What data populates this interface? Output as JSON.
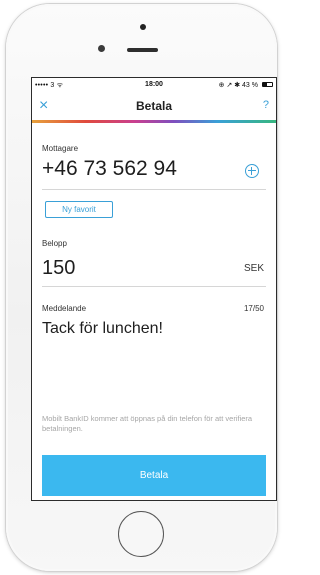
{
  "status_bar": {
    "signal_text": "••••• 3 ᯤ",
    "time": "18:00",
    "right_text": "⊕ ↗ ✱ 43 %"
  },
  "nav": {
    "close_glyph": "×",
    "title": "Betala",
    "help_label": "?"
  },
  "recipient": {
    "label": "Mottagare",
    "value": "+46 73 562 94",
    "add_icon": "plus-circle-icon",
    "favorite_label": "Ny favorit"
  },
  "amount": {
    "label": "Belopp",
    "value": "150",
    "currency": "SEK"
  },
  "message": {
    "label": "Meddelande",
    "value": "Tack för lunchen!",
    "counter": "17/50"
  },
  "info_text": "Mobilt BankID kommer att öppnas på din telefon för att verifiera betalningen.",
  "pay_button": {
    "label": "Betala"
  },
  "colors": {
    "accent": "#3aa0d7",
    "pay_button": "#3bb8ef"
  }
}
